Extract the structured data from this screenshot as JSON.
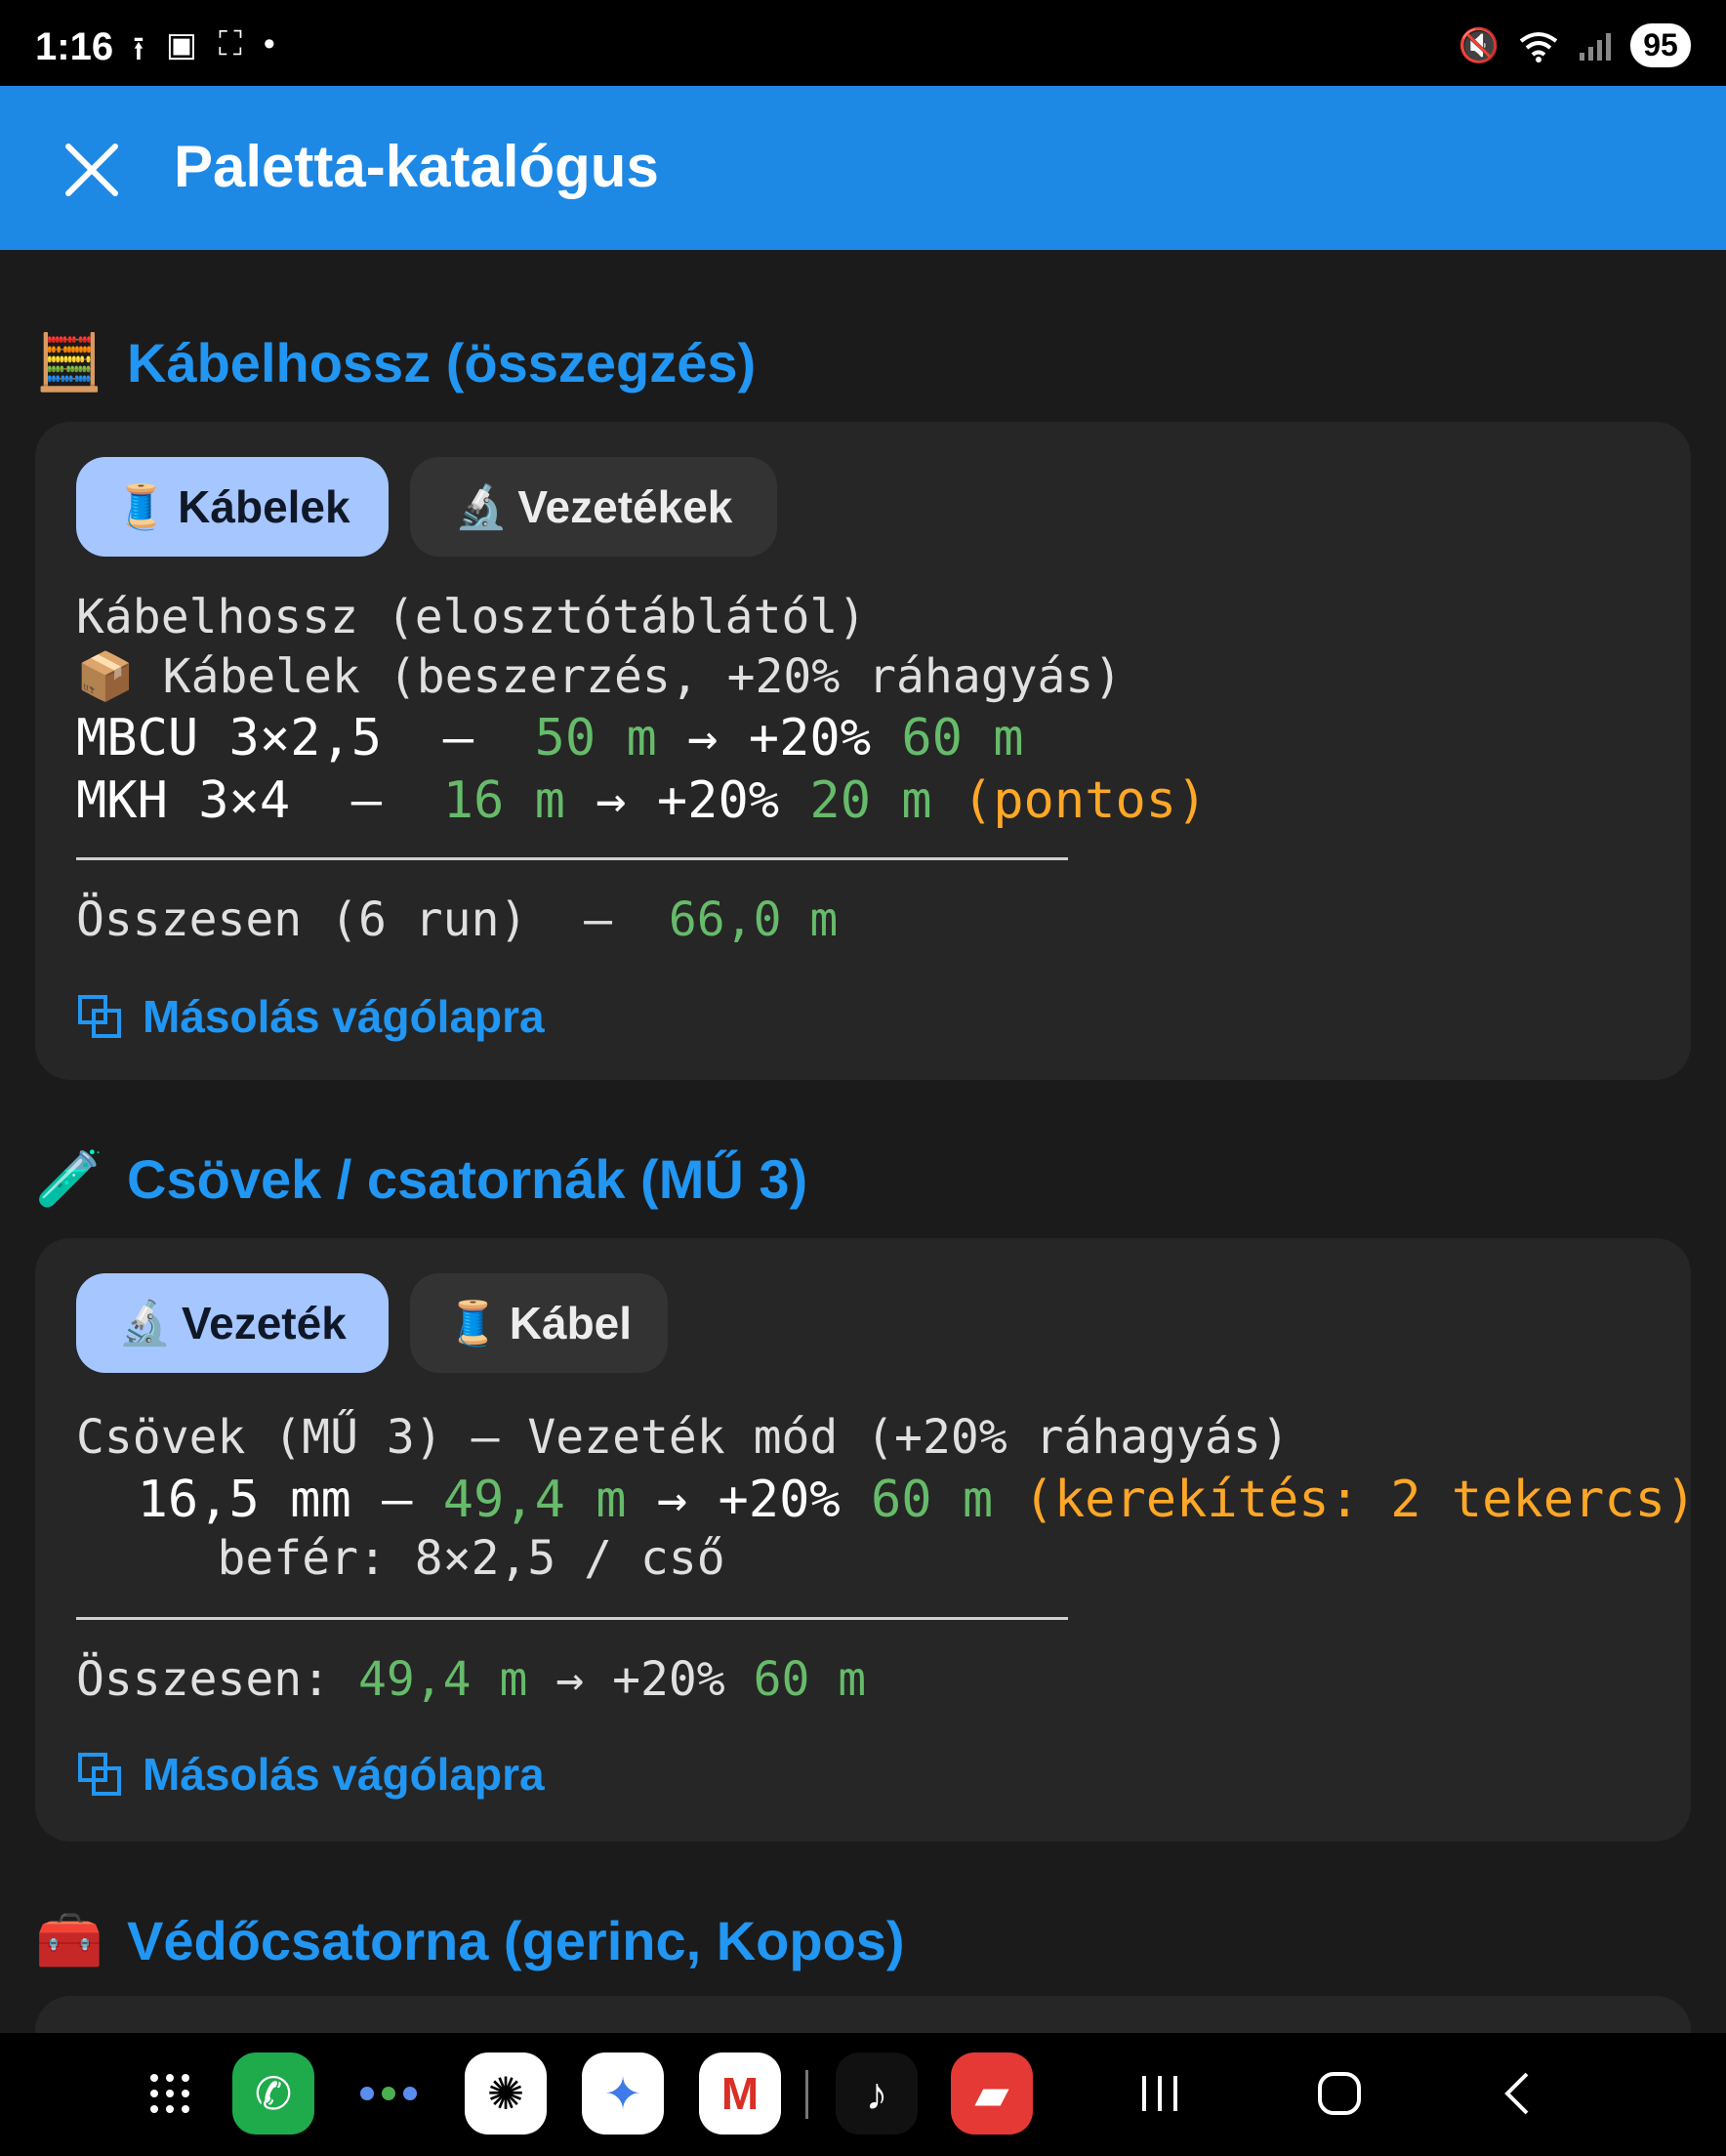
{
  "status_bar": {
    "time": "1:16",
    "battery": "95",
    "icons": [
      "upload-icon",
      "nfc-icon",
      "screenshot-icon",
      "dot-icon",
      "mute-icon",
      "wifi-icon",
      "signal-icon"
    ]
  },
  "app_bar": {
    "title": "Paletta-katalógus",
    "close_icon": "close-icon",
    "color": "#1e88e5"
  },
  "sections": [
    {
      "emoji": "🧮",
      "title": "Kábelhossz (összegzés)",
      "chips": [
        {
          "emoji": "🧵",
          "label": "Kábelek",
          "active": true
        },
        {
          "emoji": "🔬",
          "label": "Vezetékek",
          "active": false
        }
      ],
      "lines": {
        "l1": "Kábelhossz (elosztótáblától)",
        "l2_emoji": "📦",
        "l2": " Kábelek (beszerzés, +20% ráhagyás)",
        "r1_name": "MBCU 3×2,5",
        "r1_sep": "  —  ",
        "r1_len": "50 m",
        "r1_arrow": " → +20% ",
        "r1_total": "60 m",
        "r2_name": "MKH 3×4",
        "r2_sep": "  —  ",
        "r2_len": "16 m",
        "r2_arrow": " → +20% ",
        "r2_total": "20 m",
        "r2_note": " (pontos)",
        "sum_label": "Összesen (6 run)  —  ",
        "sum_value": "66,0 m"
      },
      "copy_label": "Másolás vágólapra"
    },
    {
      "emoji": "🧪",
      "title": "Csövek / csatornák (MŰ 3)",
      "chips": [
        {
          "emoji": "🔬",
          "label": "Vezeték",
          "active": true
        },
        {
          "emoji": "🧵",
          "label": "Kábel",
          "active": false
        }
      ],
      "lines": {
        "l1": "Csövek (MŰ 3) — Vezeték mód (+20% ráhagyás)",
        "r1_name": "  16,5 mm",
        "r1_sep": " — ",
        "r1_len": "49,4 m",
        "r1_arrow": " → +20% ",
        "r1_total": "60 m",
        "r1_note": " (kerekítés: 2 tekercs)",
        "r1_sub": "     befér: 8×2,5 / cső",
        "sum_label": "Összesen: ",
        "sum_value": "49,4 m",
        "sum_arrow": " → +20% ",
        "sum_total": "60 m"
      },
      "copy_label": "Másolás vágólapra"
    },
    {
      "emoji": "🧰",
      "title": "Védőcsatorna (gerinc, Kopos)"
    }
  ],
  "nav_bar": {
    "apps": [
      "apps-grid-icon",
      "phone-icon",
      "dots-icon",
      "chatgpt-icon",
      "gemini-icon",
      "gmail-icon",
      "tiktok-icon",
      "notes-icon"
    ],
    "buttons": [
      "recents-button",
      "home-button",
      "back-button"
    ]
  }
}
